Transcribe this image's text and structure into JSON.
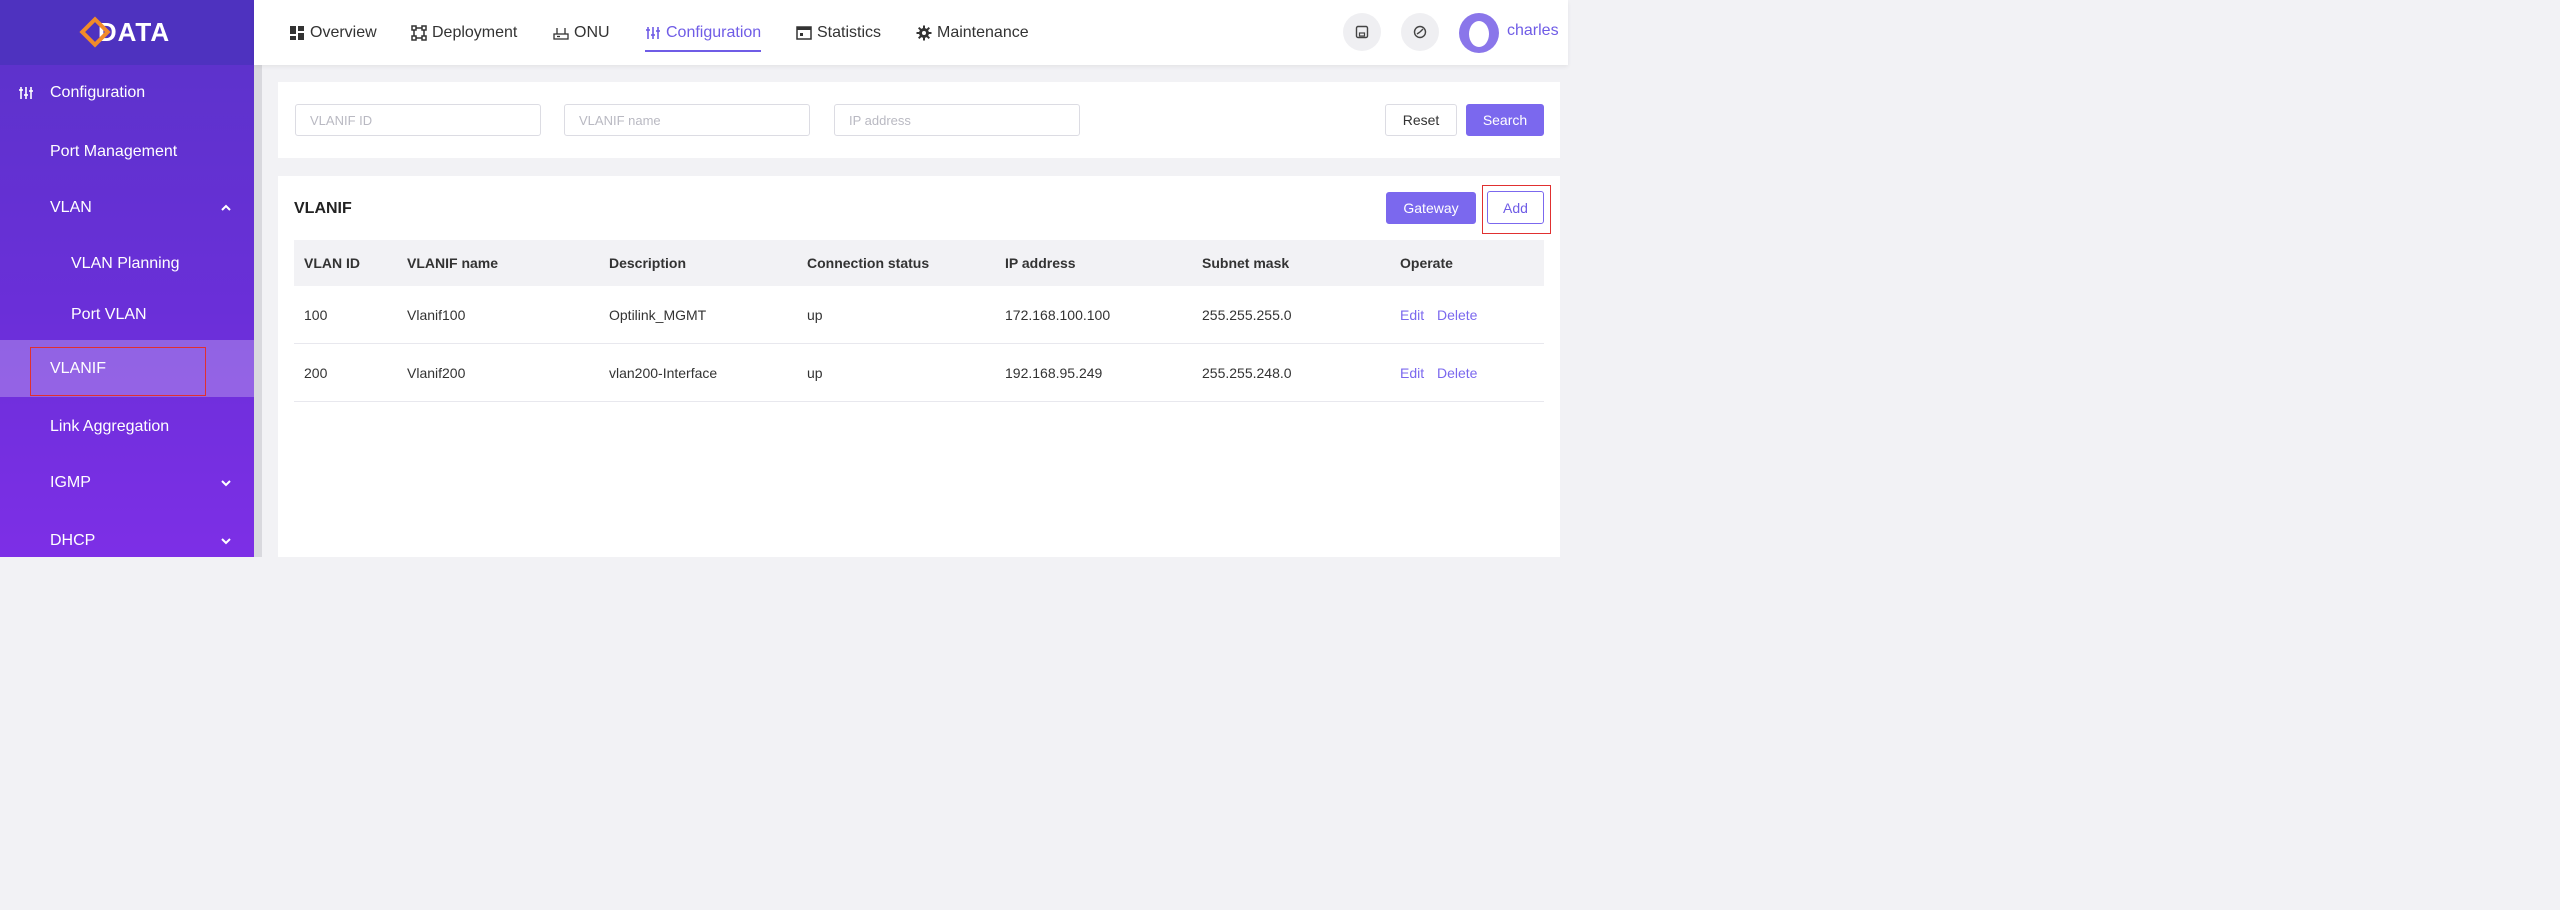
{
  "brand": {
    "logo_text": "DATA"
  },
  "sidebar": {
    "section_title": "Configuration",
    "items": [
      {
        "label": "Port Management"
      },
      {
        "label": "VLAN"
      },
      {
        "label": "VLAN Planning"
      },
      {
        "label": "Port VLAN"
      },
      {
        "label": "VLANIF"
      },
      {
        "label": "Link Aggregation"
      },
      {
        "label": "IGMP"
      },
      {
        "label": "DHCP"
      }
    ]
  },
  "nav": {
    "tabs": [
      {
        "label": "Overview",
        "icon": "dashboard-icon"
      },
      {
        "label": "Deployment",
        "icon": "topology-icon"
      },
      {
        "label": "ONU",
        "icon": "onu-device-icon"
      },
      {
        "label": "Configuration",
        "icon": "sliders-icon",
        "active": true
      },
      {
        "label": "Statistics",
        "icon": "statistics-window-icon"
      },
      {
        "label": "Maintenance",
        "icon": "gear-icon"
      }
    ],
    "username": "charles"
  },
  "filters": {
    "vlanif_id_placeholder": "VLANIF ID",
    "vlanif_name_placeholder": "VLANIF name",
    "ip_address_placeholder": "IP address",
    "reset_label": "Reset",
    "search_label": "Search"
  },
  "table": {
    "title": "VLANIF",
    "gateway_label": "Gateway",
    "add_label": "Add",
    "columns": [
      "VLAN ID",
      "VLANIF name",
      "Description",
      "Connection status",
      "IP address",
      "Subnet mask",
      "Operate"
    ],
    "rows": [
      {
        "vlan_id": "100",
        "name": "Vlanif100",
        "description": "Optilink_MGMT",
        "status": "up",
        "ip": "172.168.100.100",
        "mask": "255.255.255.0",
        "edit": "Edit",
        "delete": "Delete"
      },
      {
        "vlan_id": "200",
        "name": "Vlanif200",
        "description": "vlan200-Interface",
        "status": "up",
        "ip": "192.168.95.249",
        "mask": "255.255.248.0",
        "edit": "Edit",
        "delete": "Delete"
      }
    ]
  },
  "colors": {
    "accent": "#7b68ee",
    "sidebar_top": "#5a33c9",
    "sidebar_bottom": "#7d2fe6",
    "highlight_box": "#e03030",
    "logo_orange": "#f28b2a"
  }
}
